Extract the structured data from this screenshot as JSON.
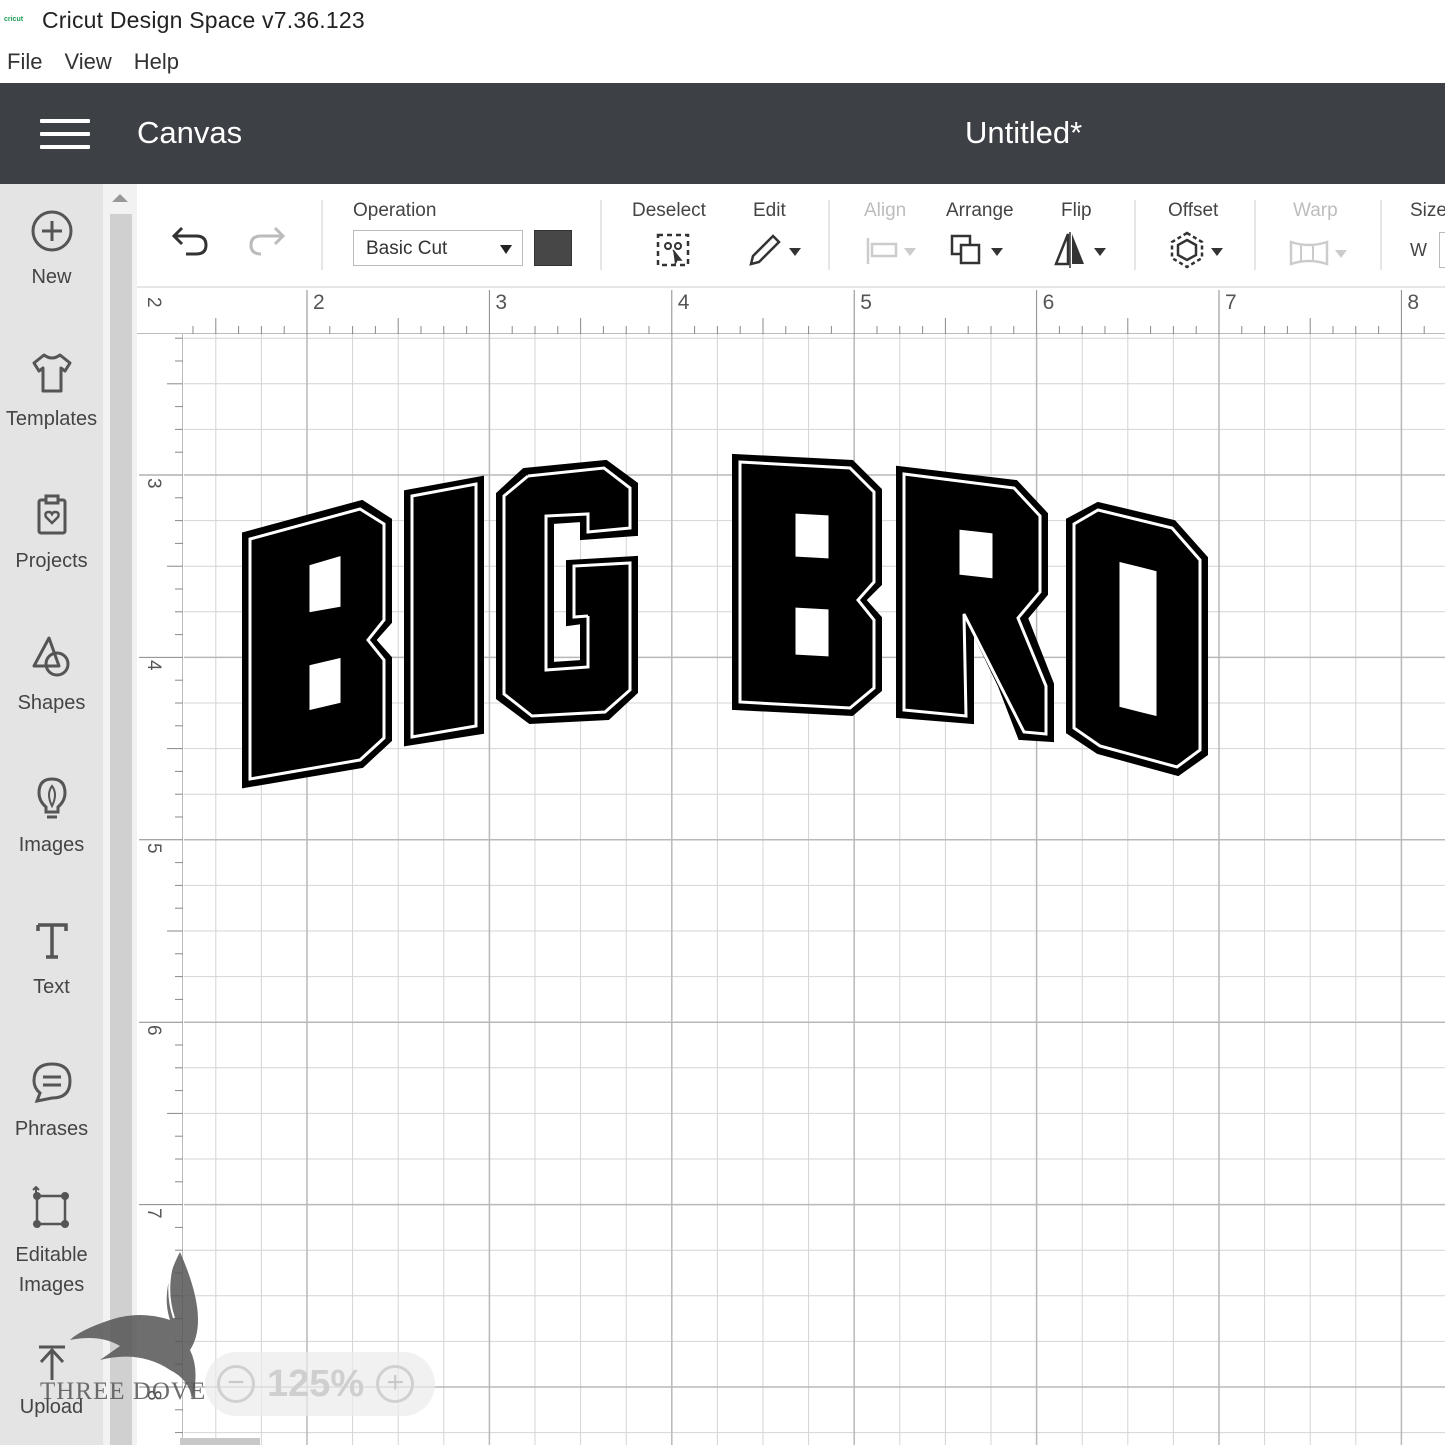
{
  "window": {
    "title": "Cricut Design Space  v7.36.123",
    "logo_text": "cricut"
  },
  "menu": [
    {
      "label": "File"
    },
    {
      "label": "View"
    },
    {
      "label": "Help"
    }
  ],
  "header": {
    "section": "Canvas",
    "document_title": "Untitled*"
  },
  "sidebar": {
    "items": [
      {
        "label": "New",
        "icon": "plus-circle-icon"
      },
      {
        "label": "Templates",
        "icon": "tshirt-icon"
      },
      {
        "label": "Projects",
        "icon": "clipboard-heart-icon"
      },
      {
        "label": "Shapes",
        "icon": "shapes-icon"
      },
      {
        "label": "Images",
        "icon": "lightbulb-icon"
      },
      {
        "label": "Text",
        "icon": "text-t-icon"
      },
      {
        "label": "Phrases",
        "icon": "speech-bubble-icon"
      },
      {
        "label": "Editable Images",
        "icon": "editable-image-icon"
      },
      {
        "label": "Upload",
        "icon": "upload-arrow-icon"
      }
    ]
  },
  "toolbar": {
    "undo_icon": "undo-icon",
    "redo_icon": "redo-icon",
    "operation_label": "Operation",
    "operation_value": "Basic Cut",
    "operation_color": "#474747",
    "deselect_label": "Deselect",
    "edit_label": "Edit",
    "align_label": "Align",
    "arrange_label": "Arrange",
    "flip_label": "Flip",
    "offset_label": "Offset",
    "warp_label": "Warp",
    "size_label": "Size",
    "size_w_label": "W"
  },
  "rulers": {
    "horizontal": [
      "2",
      "3",
      "4",
      "5",
      "6",
      "7",
      "8"
    ],
    "vertical": [
      "2",
      "3",
      "4",
      "5",
      "6",
      "7",
      "8"
    ]
  },
  "canvas": {
    "design_words": [
      "BIG",
      "BRO"
    ]
  },
  "zoom": {
    "value": "125%",
    "minus": "−",
    "plus": "+"
  },
  "watermark": {
    "text": "THREE DOVE"
  },
  "colors": {
    "header_bg": "#3d4044",
    "sidebar_bg": "#e4e4e4",
    "design_fill": "#000000"
  }
}
